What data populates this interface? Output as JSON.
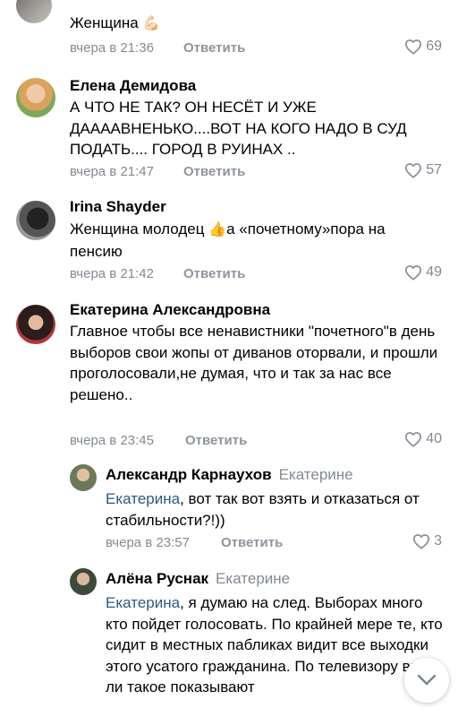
{
  "comments": [
    {
      "name": "",
      "text": "Женщина",
      "emoji": "💪🏻",
      "date": "вчера в 21:36",
      "reply_label": "Ответить",
      "likes": "69"
    },
    {
      "name": "Елена Демидова",
      "text": "А ЧТО НЕ ТАК?   ОН НЕСЁТ И УЖЕ ДААААВНЕНЬКО....ВОТ НА КОГО НАДО В СУД ПОДАТЬ.... ГОРОД В РУИНАХ ..",
      "date": "вчера в 21:47",
      "reply_label": "Ответить",
      "likes": "57"
    },
    {
      "name": "Irina Shayder",
      "text_before": "Женщина молодец ",
      "emoji": "👍",
      "text_after": "а «почетному»пора на пенсию",
      "date": "вчера в 21:42",
      "reply_label": "Ответить",
      "likes": "49"
    },
    {
      "name": "Екатерина Александровна",
      "text": "Главное чтобы все ненавистники \"почетного\"в день выборов свои жопы от диванов оторвали, и прошли проголосовали,не думая, что и так за нас все решено..",
      "date": "вчера в 23:45",
      "reply_label": "Ответить",
      "likes": "40"
    },
    {
      "name": "Александр Карнаухов",
      "reply_to": "Екатерине",
      "mention": "Екатерина",
      "text": ", вот так вот взять и отказаться от стабильности?!))",
      "date": "вчера в 23:57",
      "reply_label": "Ответить",
      "likes": "3"
    },
    {
      "name": "Алёна Руснак",
      "reply_to": "Екатерине",
      "mention": "Екатерина",
      "text": ", я думаю на след. Выборах много кто пойдет голосовать. По крайней мере те, кто сидит в местных пабликах видит все выходки этого усатого гражданина. По телевизору вряд ли такое показывают"
    }
  ],
  "icons": {
    "like": "heart-outline-icon",
    "scroll": "chevron-down-icon"
  },
  "colors": {
    "link": "#2a5885",
    "meta": "#828a93"
  }
}
